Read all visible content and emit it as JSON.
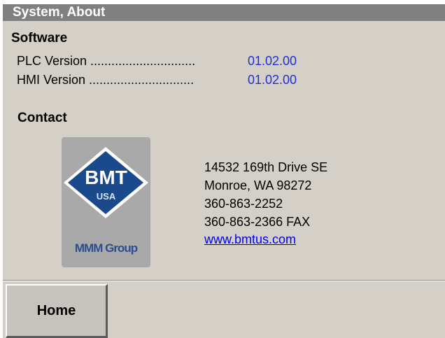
{
  "window": {
    "title": "System, About"
  },
  "software": {
    "heading": "Software",
    "rows": [
      {
        "label": "PLC Version ..............................",
        "value": "01.02.00"
      },
      {
        "label": "HMI Version ..............................",
        "value": "01.02.00"
      }
    ]
  },
  "contact": {
    "heading": "Contact",
    "logo": {
      "brand": "BMT",
      "sub": "USA",
      "group": "MMM Group"
    },
    "address_lines": [
      "14532 169th Drive SE",
      "Monroe, WA  98272",
      "360-863-2252",
      "360-863-2366  FAX"
    ],
    "website": "www.bmtus.com"
  },
  "footer": {
    "home_label": "Home"
  },
  "colors": {
    "value_text": "#1f2fd6",
    "titlebar": "#808080",
    "panel": "#d4d0c8",
    "logo_diamond": "#1a4a8c"
  }
}
